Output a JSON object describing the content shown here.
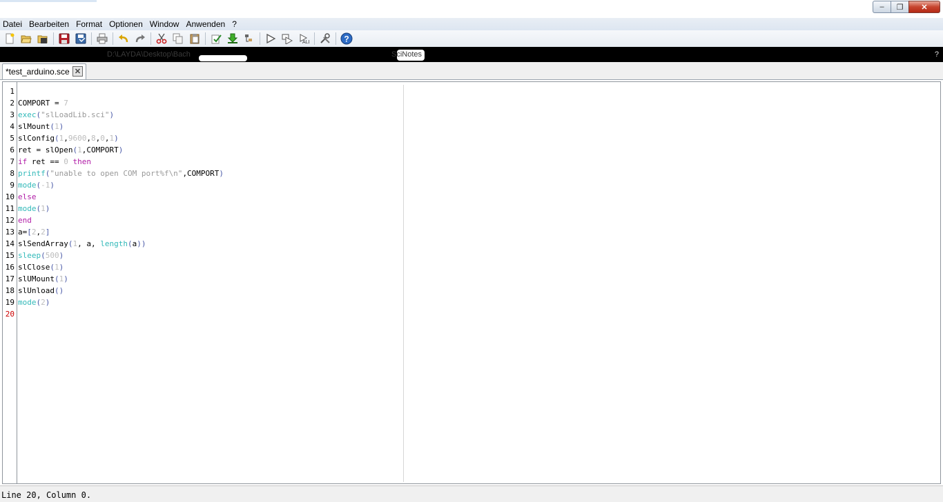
{
  "window": {
    "controls": [
      "–",
      "❐",
      "✕"
    ]
  },
  "menu": [
    "Datei",
    "Bearbeiten",
    "Format",
    "Optionen",
    "Window",
    "Anwenden",
    "?"
  ],
  "toolbar": {
    "icons": [
      "new-file-icon",
      "open-file-icon",
      "open-recent-icon",
      "save-icon",
      "save-as-icon",
      "print-icon",
      "undo-icon",
      "redo-icon",
      "cut-icon",
      "copy-icon",
      "paste-icon",
      "check-icon",
      "load-into-scilab-icon",
      "execute-icon",
      "run-icon",
      "run-with-echo-icon",
      "run-tests-icon",
      "tools-icon",
      "help-icon"
    ]
  },
  "pathbar": {
    "path": "D:\\LAYDA\\Desktop\\Bach",
    "console": "SciNotes",
    "undock_label": "?"
  },
  "tab": {
    "title": "*test_arduino.sce",
    "close_label": "✕"
  },
  "editor": {
    "line_numbers": [
      "1",
      "2",
      "3",
      "4",
      "5",
      "6",
      "7",
      "8",
      "9",
      "10",
      "11",
      "12",
      "13",
      "14",
      "15",
      "16",
      "17",
      "18",
      "19",
      "20"
    ],
    "current_line": 20,
    "lines": [
      [],
      [
        {
          "t": "COMPORT",
          "c": "plain"
        },
        {
          "t": " = ",
          "c": "plain"
        },
        {
          "t": "7",
          "c": "num"
        }
      ],
      [
        {
          "t": "exec",
          "c": "fn"
        },
        {
          "t": "(",
          "c": "par"
        },
        {
          "t": "\"slLoadLib.sci\"",
          "c": "str"
        },
        {
          "t": ")",
          "c": "par"
        }
      ],
      [
        {
          "t": "slMount",
          "c": "plain"
        },
        {
          "t": "(",
          "c": "par"
        },
        {
          "t": "1",
          "c": "num"
        },
        {
          "t": ")",
          "c": "par"
        }
      ],
      [
        {
          "t": "slConfig",
          "c": "plain"
        },
        {
          "t": "(",
          "c": "par"
        },
        {
          "t": "1",
          "c": "num"
        },
        {
          "t": ",",
          "c": "plain"
        },
        {
          "t": "9600",
          "c": "num"
        },
        {
          "t": ",",
          "c": "plain"
        },
        {
          "t": "8",
          "c": "num"
        },
        {
          "t": ",",
          "c": "plain"
        },
        {
          "t": "0",
          "c": "num"
        },
        {
          "t": ",",
          "c": "plain"
        },
        {
          "t": "1",
          "c": "num"
        },
        {
          "t": ")",
          "c": "par"
        }
      ],
      [
        {
          "t": "ret = slOpen",
          "c": "plain"
        },
        {
          "t": "(",
          "c": "par"
        },
        {
          "t": "1",
          "c": "num"
        },
        {
          "t": ",COMPORT",
          "c": "plain"
        },
        {
          "t": ")",
          "c": "par"
        }
      ],
      [
        {
          "t": "if",
          "c": "kw"
        },
        {
          "t": " ret == ",
          "c": "plain"
        },
        {
          "t": "0",
          "c": "num"
        },
        {
          "t": " ",
          "c": "plain"
        },
        {
          "t": "then",
          "c": "kw"
        }
      ],
      [
        {
          "t": "printf",
          "c": "fn"
        },
        {
          "t": "(",
          "c": "par"
        },
        {
          "t": "\"unable to open COM port%f\\n\"",
          "c": "str"
        },
        {
          "t": ",COMPORT",
          "c": "plain"
        },
        {
          "t": ")",
          "c": "par"
        }
      ],
      [
        {
          "t": "mode",
          "c": "fn"
        },
        {
          "t": "(",
          "c": "par"
        },
        {
          "t": "-1",
          "c": "num"
        },
        {
          "t": ")",
          "c": "par"
        }
      ],
      [
        {
          "t": "else",
          "c": "kw"
        }
      ],
      [
        {
          "t": "mode",
          "c": "fn"
        },
        {
          "t": "(",
          "c": "par"
        },
        {
          "t": "1",
          "c": "num"
        },
        {
          "t": ")",
          "c": "par"
        }
      ],
      [
        {
          "t": "end",
          "c": "kw"
        }
      ],
      [
        {
          "t": "a=",
          "c": "plain"
        },
        {
          "t": "[",
          "c": "par"
        },
        {
          "t": "2",
          "c": "num"
        },
        {
          "t": ",",
          "c": "plain"
        },
        {
          "t": "2",
          "c": "num"
        },
        {
          "t": "]",
          "c": "par"
        }
      ],
      [
        {
          "t": "slSendArray",
          "c": "plain"
        },
        {
          "t": "(",
          "c": "par"
        },
        {
          "t": "1",
          "c": "num"
        },
        {
          "t": ", a, ",
          "c": "plain"
        },
        {
          "t": "length",
          "c": "fn"
        },
        {
          "t": "(",
          "c": "par"
        },
        {
          "t": "a",
          "c": "plain"
        },
        {
          "t": "))",
          "c": "par"
        }
      ],
      [
        {
          "t": "sleep",
          "c": "fn"
        },
        {
          "t": "(",
          "c": "par"
        },
        {
          "t": "500",
          "c": "num"
        },
        {
          "t": ")",
          "c": "par"
        }
      ],
      [
        {
          "t": "slClose",
          "c": "plain"
        },
        {
          "t": "(",
          "c": "par"
        },
        {
          "t": "1",
          "c": "num"
        },
        {
          "t": ")",
          "c": "par"
        }
      ],
      [
        {
          "t": "slUMount",
          "c": "plain"
        },
        {
          "t": "(",
          "c": "par"
        },
        {
          "t": "1",
          "c": "num"
        },
        {
          "t": ")",
          "c": "par"
        }
      ],
      [
        {
          "t": "slUnload",
          "c": "plain"
        },
        {
          "t": "()",
          "c": "par"
        }
      ],
      [
        {
          "t": "mode",
          "c": "fn"
        },
        {
          "t": "(",
          "c": "par"
        },
        {
          "t": "2",
          "c": "num"
        },
        {
          "t": ")",
          "c": "par"
        }
      ],
      []
    ]
  },
  "status": {
    "text": "Line 20, Column 0."
  },
  "colors": {
    "function": "#32b9b9",
    "string": "#999999",
    "number": "#bcbcbc",
    "keyword": "#b01ba6",
    "bracket": "#4a5aa8",
    "current_line_number": "#cc0000"
  }
}
